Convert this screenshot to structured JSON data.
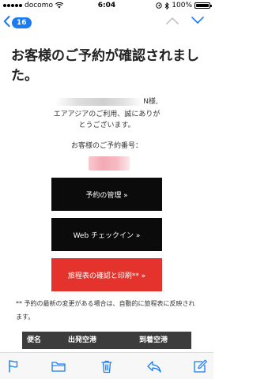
{
  "colors": {
    "accent": "#1a7cf5",
    "red_button": "#e4332c",
    "dark_button": "#0b0b0b",
    "table_header": "#3c3c3c"
  },
  "status_bar": {
    "carrier": "docomo",
    "time": "6:04",
    "battery": "100%"
  },
  "nav": {
    "back_count": "16"
  },
  "email": {
    "heading": "お客様のご予約が確認されました。",
    "greeting_suffix": "N様,",
    "greeting_line2": "エアアジアのご利用、誠にありが",
    "greeting_line3": "とうございます。",
    "reservation_label": "お客様のご予約番号：",
    "buttons": {
      "manage": "予約の管理 »",
      "web_checkin": "Web チェックイン »",
      "itinerary": "旅程表の確認と印刷** »"
    },
    "note": "** 予約の最新の変更がある場合は、自動的に旅程表に反映されます。",
    "table_headers": [
      "便名",
      "出発空港",
      "到着空港"
    ]
  },
  "toolbar_icons": [
    "flag-icon",
    "folder-icon",
    "trash-icon",
    "reply-icon",
    "compose-icon"
  ]
}
